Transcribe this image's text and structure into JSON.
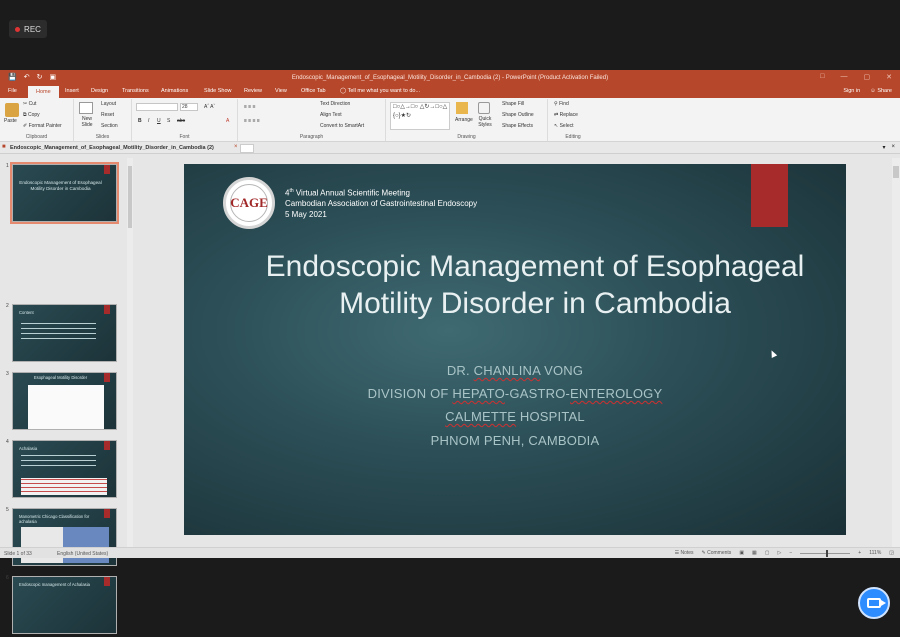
{
  "meeting": {
    "rec_label": "REC"
  },
  "window": {
    "title": "Endoscopic_Management_of_Esophageal_Motility_Disorder_in_Cambodia (2) - PowerPoint (Product Activation Failed)"
  },
  "ribbon_tabs": [
    "File",
    "Home",
    "Insert",
    "Design",
    "Transitions",
    "Animations",
    "Slide Show",
    "Review",
    "View",
    "Office Tab"
  ],
  "tell_me": "Tell me what you want to do...",
  "account": {
    "sign_in": "Sign in",
    "share": "Share"
  },
  "ribbon": {
    "clipboard": {
      "paste": "Paste",
      "cut": "Cut",
      "copy": "Copy",
      "format_painter": "Format Painter",
      "label": "Clipboard"
    },
    "slides": {
      "new_slide": "New Slide",
      "layout": "Layout",
      "reset": "Reset",
      "section": "Section",
      "label": "Slides"
    },
    "font": {
      "size": "28",
      "label": "Font"
    },
    "paragraph": {
      "text_direction": "Text Direction",
      "align_text": "Align Text",
      "smartart": "Convert to SmartArt",
      "label": "Paragraph"
    },
    "drawing": {
      "arrange": "Arrange",
      "quick_styles": "Quick Styles",
      "shape_fill": "Shape Fill",
      "shape_outline": "Shape Outline",
      "shape_effects": "Shape Effects",
      "label": "Drawing"
    },
    "editing": {
      "find": "Find",
      "replace": "Replace",
      "select": "Select",
      "label": "Editing"
    }
  },
  "doc_tab": {
    "name": "Endoscopic_Management_of_Esophageal_Motility_Disorder_in_Cambodia (2)"
  },
  "thumbnails": [
    {
      "num": "1",
      "title": "Endoscopic Management of Esophageal Motility Disorder in Cambodia"
    },
    {
      "num": "2",
      "title": "Content"
    },
    {
      "num": "3",
      "title": "Esophageal Motility Disorder"
    },
    {
      "num": "4",
      "title": "Achalasia"
    },
    {
      "num": "5",
      "title": "Manometric Chicago Classification for achalasia"
    },
    {
      "num": "6",
      "title": "Endoscopic management of Achalasia"
    }
  ],
  "slide": {
    "logo_text": "CAGE",
    "meeting_line1_num": "4",
    "meeting_line1_sup": "th",
    "meeting_line1_rest": " Virtual Annual Scientific Meeting",
    "meeting_line2": "Cambodian Association of Gastrointestinal Endoscopy",
    "meeting_line3": "5 May 2021",
    "title": "Endoscopic Management of Esophageal Motility Disorder in Cambodia",
    "author_pre": "DR. ",
    "author_sq": "CHANLINA",
    "author_post": " VONG",
    "division_pre": "DIVISION OF ",
    "division_sq1": "HEPATO",
    "division_mid": "-GASTRO-",
    "division_sq2": "ENTEROLOGY",
    "hospital_sq": "CALMETTE",
    "hospital_post": " HOSPITAL",
    "location": "PHNOM PENH, CAMBODIA"
  },
  "status": {
    "slide_of": "Slide 1 of 33",
    "language": "English (United States)",
    "notes": "Notes",
    "comments": "Comments",
    "zoom": "111%"
  }
}
